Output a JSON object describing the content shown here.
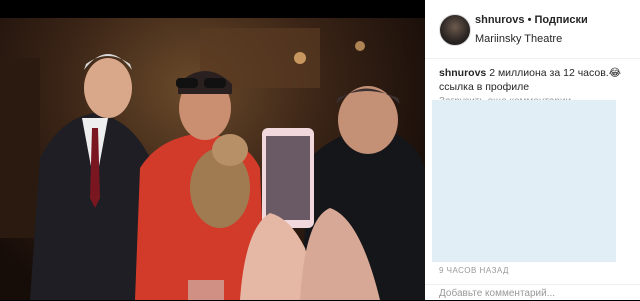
{
  "post": {
    "username": "shnurovs",
    "separator": "•",
    "follow_label": "Подписки",
    "location": "Mariinsky Theatre",
    "caption_user": "shnurovs",
    "caption_text": "2 миллиона за 12 часов.😂 ссылка в профиле",
    "comment_ghost": "Загрузить еще комментарии",
    "time_ago": "9 часов назад",
    "add_comment_placeholder": "Добавьте комментарий..."
  },
  "colors": {
    "panel_bg": "#ffffff",
    "overlay": "#e2eef6",
    "text": "#262626",
    "muted": "#999999"
  }
}
